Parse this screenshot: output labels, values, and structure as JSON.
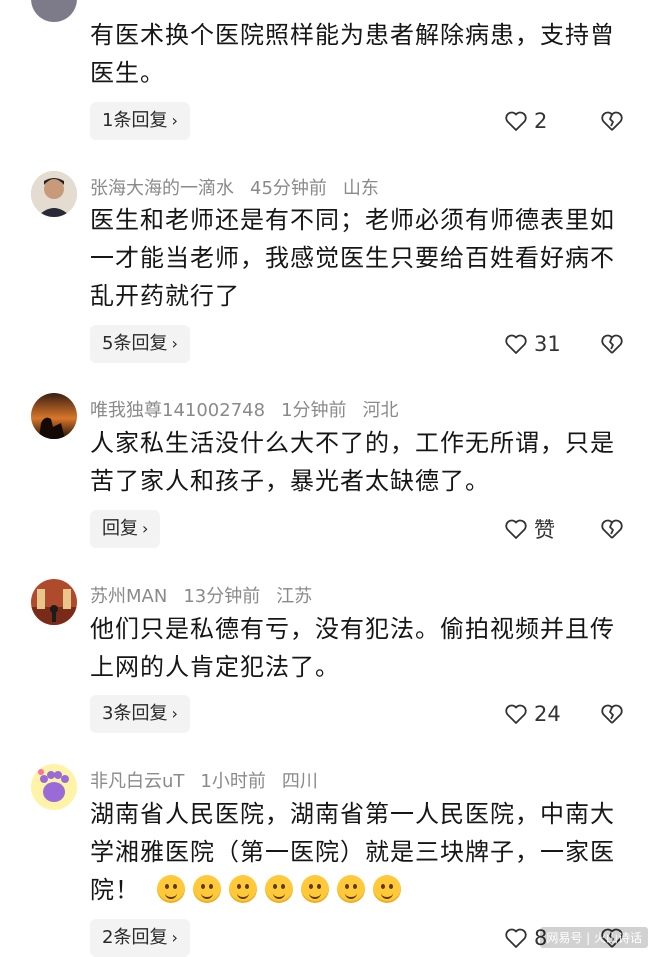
{
  "comments": [
    {
      "author": "",
      "time": "",
      "location": "",
      "text": "有医术换个医院照样能为患者解除病患，支持曾医生。",
      "reply_label": "1条回复",
      "likes": "2"
    },
    {
      "author": "张海大海的一滴水",
      "time": "45分钟前",
      "location": "山东",
      "text": "医生和老师还是有不同；老师必须有师德表里如一才能当老师，我感觉医生只要给百姓看好病不乱开药就行了",
      "reply_label": "5条回复",
      "likes": "31"
    },
    {
      "author": "唯我独尊141002748",
      "time": "1分钟前",
      "location": "河北",
      "text": "人家私生活没什么大不了的，工作无所谓，只是苦了家人和孩子，暴光者太缺德了。",
      "reply_label": "回复",
      "likes": "赞"
    },
    {
      "author": "苏州MAN",
      "time": "13分钟前",
      "location": "江苏",
      "text": "他们只是私德有亏，没有犯法。偷拍视频并且传上网的人肯定犯法了。",
      "reply_label": "3条回复",
      "likes": "24"
    },
    {
      "author": "非凡白云uT",
      "time": "1小时前",
      "location": "四川",
      "text": "湖南省人民医院，湖南省第一人民医院，中南大学湘雅医院（第一医院）就是三块牌子，一家医院！",
      "reply_label": "2条回复",
      "likes": "8"
    }
  ],
  "icons": {
    "chevron": "chevron-right-icon",
    "like": "heart-outline-icon",
    "dislike": "broken-heart-icon"
  },
  "watermark": "网易号 | 火山诗话",
  "colors": {
    "meta": "#8a8a8a",
    "text": "#161616",
    "reply_bg": "#f3f3f3"
  }
}
